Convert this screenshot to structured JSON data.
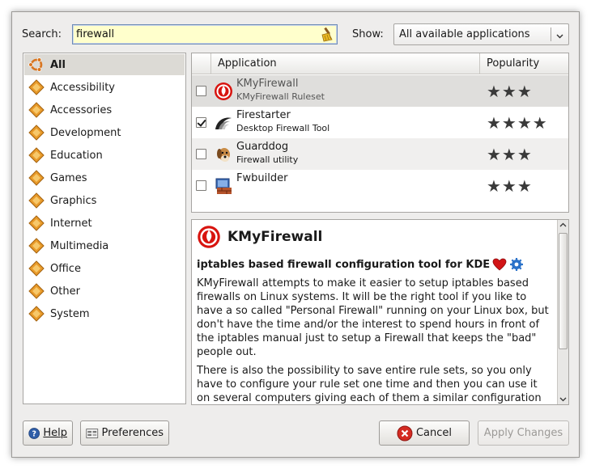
{
  "search": {
    "label": "Search:",
    "value": "firewall"
  },
  "show": {
    "label": "Show:",
    "selected": "All available applications"
  },
  "categories": [
    {
      "label": "All",
      "selected": true
    },
    {
      "label": "Accessibility"
    },
    {
      "label": "Accessories"
    },
    {
      "label": "Development"
    },
    {
      "label": "Education"
    },
    {
      "label": "Games"
    },
    {
      "label": "Graphics"
    },
    {
      "label": "Internet"
    },
    {
      "label": "Multimedia"
    },
    {
      "label": "Office"
    },
    {
      "label": "Other"
    },
    {
      "label": "System"
    }
  ],
  "table": {
    "col_application": "Application",
    "col_popularity": "Popularity",
    "rows": [
      {
        "name": "KMyFirewall",
        "desc": "KMyFirewall Ruleset",
        "checked": false,
        "stars": "★★★",
        "icon": "kmyfirewall-icon"
      },
      {
        "name": "Firestarter",
        "desc": "Desktop Firewall Tool",
        "checked": true,
        "stars": "★★★★",
        "icon": "firestarter-icon"
      },
      {
        "name": "Guarddog",
        "desc": "Firewall utility",
        "checked": false,
        "stars": "★★★",
        "icon": "guarddog-icon"
      },
      {
        "name": "Fwbuilder",
        "desc": "",
        "checked": false,
        "stars": "★★★",
        "icon": "fwbuilder-icon"
      }
    ]
  },
  "description": {
    "title": "KMyFirewall",
    "subtitle": "iptables based firewall configuration tool for KDE",
    "para1": "KMyFirewall attempts to make it easier to setup iptables based firewalls on Linux systems. It will be the right tool if you like to have a so called \"Personal Firewall\" running on your Linux box, but don't have the time and/or the interest to spend hours in front of the iptables manual just to setup a Firewall that keeps the \"bad\" people out.",
    "para2": "There is also the possibility to save entire rule sets, so you only have to configure your rule set one time and then you can use it on several computers giving each of them a similar configuration (p.e. school networks, office, university etc.)."
  },
  "buttons": {
    "help": "Help",
    "preferences": "Preferences",
    "cancel": "Cancel",
    "apply": "Apply Changes"
  },
  "colors": {
    "search_bg": "#ffffcc",
    "selection_bg": "#dcdad5",
    "window_bg": "#eeedec"
  }
}
